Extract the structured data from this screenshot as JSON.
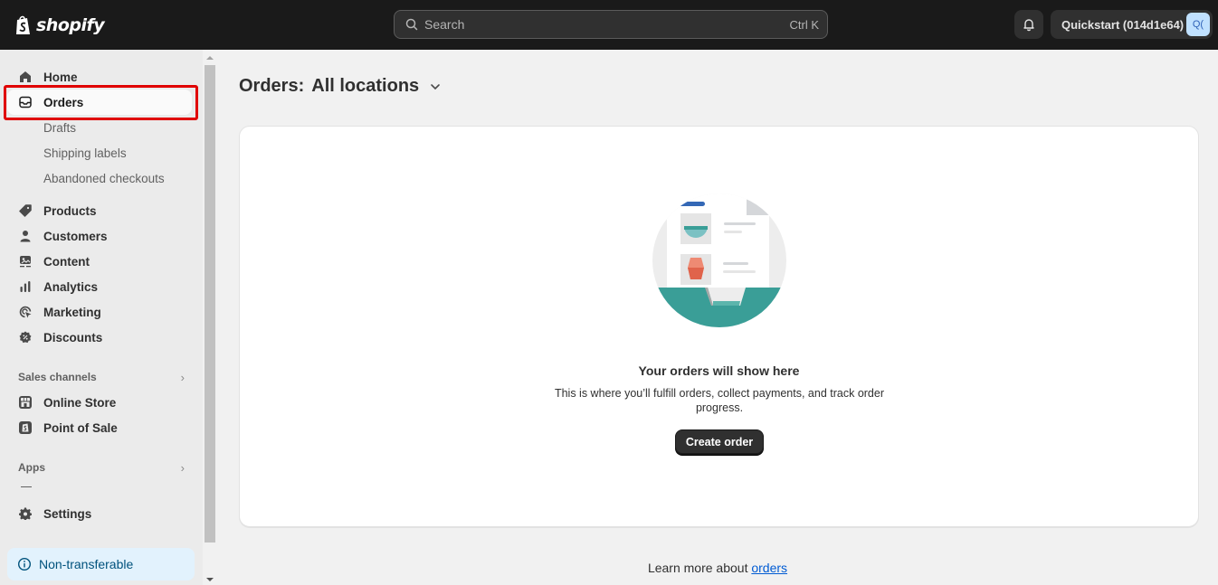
{
  "topbar": {
    "logo_text": "shopify",
    "search_placeholder": "Search",
    "search_shortcut": "Ctrl K",
    "store_name": "Quickstart (014d1e64)",
    "store_avatar": "Q("
  },
  "sidebar": {
    "items": [
      {
        "label": "Home",
        "icon": "home-icon"
      },
      {
        "label": "Orders",
        "icon": "orders-icon",
        "active": true
      },
      {
        "label": "Products",
        "icon": "tag-icon"
      },
      {
        "label": "Customers",
        "icon": "person-icon"
      },
      {
        "label": "Content",
        "icon": "content-icon"
      },
      {
        "label": "Analytics",
        "icon": "bar-chart-icon"
      },
      {
        "label": "Marketing",
        "icon": "target-icon"
      },
      {
        "label": "Discounts",
        "icon": "discount-icon"
      }
    ],
    "order_subitems": [
      "Drafts",
      "Shipping labels",
      "Abandoned checkouts"
    ],
    "sales_channels": {
      "heading": "Sales channels",
      "items": [
        {
          "label": "Online Store",
          "icon": "store-icon"
        },
        {
          "label": "Point of Sale",
          "icon": "pos-icon"
        }
      ]
    },
    "apps": {
      "heading": "Apps"
    },
    "settings": {
      "label": "Settings",
      "icon": "gear-icon"
    },
    "badge": {
      "label": "Non-transferable",
      "icon": "info-icon"
    }
  },
  "main": {
    "title": "Orders:",
    "location": "All locations",
    "empty_state": {
      "title": "Your orders will show here",
      "description": "This is where you’ll fulfill orders, collect payments, and track order progress.",
      "button": "Create order"
    },
    "footer": {
      "text": "Learn more about ",
      "link": "orders"
    }
  },
  "colors": {
    "topbar_bg": "#1a1a1a",
    "sidebar_bg": "#ebebeb",
    "page_bg": "#f1f1f1",
    "highlight": "#e00000",
    "link": "#005bd3",
    "badge_bg": "#e2f2fd",
    "teal": "#3a9e97"
  }
}
